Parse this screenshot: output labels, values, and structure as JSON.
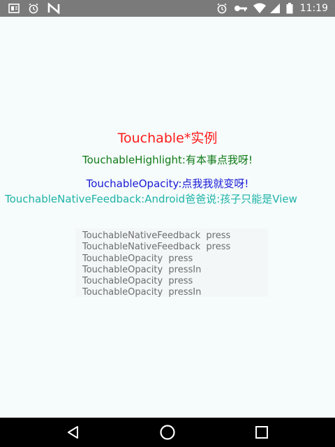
{
  "status_bar": {
    "time": "11:19",
    "left_icons": [
      "document-icon",
      "alarm-icon",
      "n-logo-icon"
    ],
    "right_icons": [
      "alarm-icon",
      "key-icon",
      "wifi-icon",
      "signal-icon",
      "battery-icon"
    ]
  },
  "main": {
    "title": "Touchable*实例",
    "highlight_text": "TouchableHighlight:有本事点我呀!",
    "opacity_text": "TouchableOpacity:点我我就变呀!",
    "native_feedback_text": "TouchableNativeFeedback:Android爸爸说:孩子只能是View"
  },
  "log": {
    "entries": [
      "TouchableNativeFeedback  press",
      "TouchableNativeFeedback  press",
      "TouchableOpacity  press",
      "TouchableOpacity  pressIn",
      "TouchableOpacity  press",
      "TouchableOpacity  pressIn"
    ]
  },
  "nav_bar": {
    "buttons": [
      "back-icon",
      "home-icon",
      "recents-icon"
    ]
  },
  "colors": {
    "title": "#ff1a1a",
    "highlight": "#117a17",
    "opacity": "#1a1ad6",
    "native_feedback": "#1fb2a8",
    "log_text": "#6d6d6d",
    "background": "#f5fcfb"
  }
}
